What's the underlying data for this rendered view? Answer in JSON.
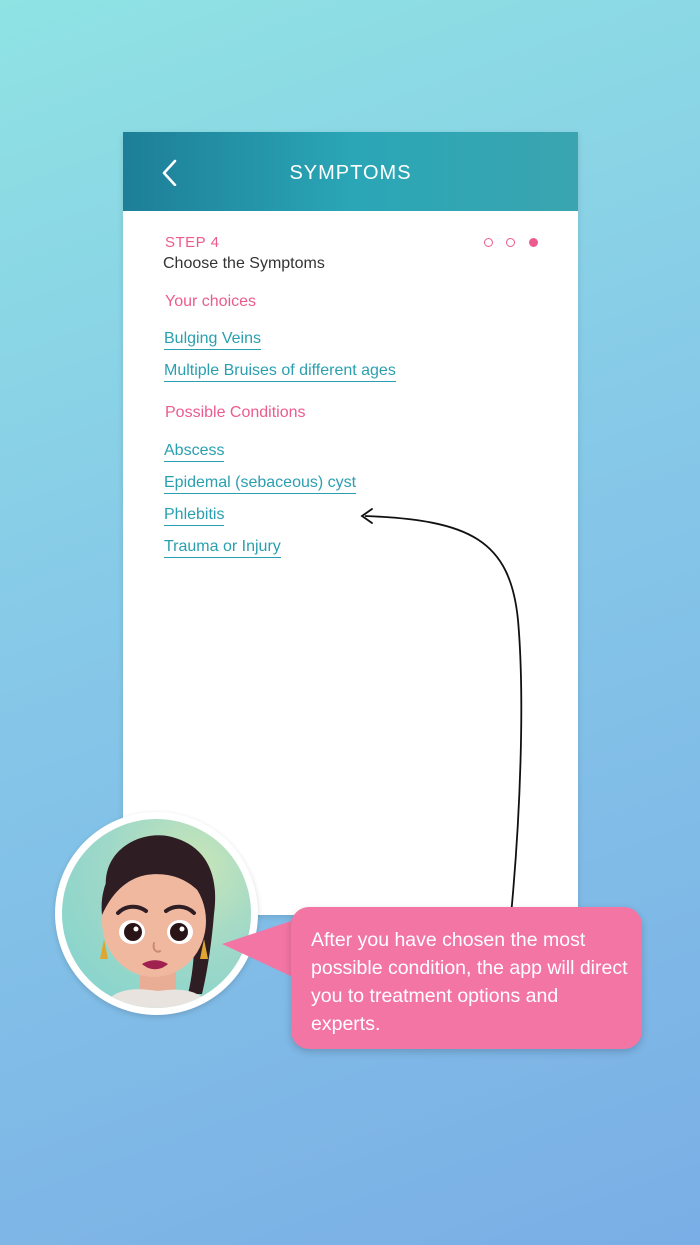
{
  "header": {
    "title": "SYMPTOMS",
    "back_icon": "chevron-left-icon"
  },
  "step": {
    "label": "STEP 4",
    "subtitle": "Choose the Symptoms",
    "current": 3,
    "total": 3
  },
  "your_choices": {
    "heading": "Your choices",
    "items": [
      "Bulging Veins ",
      "Multiple Bruises of different ages"
    ]
  },
  "possible_conditions": {
    "heading": "Possible Conditions",
    "items": [
      "Abscess",
      "Epidemal (sebaceous) cyst",
      "Phlebitis",
      "Trauma or Injury"
    ]
  },
  "tooltip": {
    "text": "After you have chosen the most possible condition, the app will direct you to treatment options and experts."
  },
  "colors": {
    "accent_pink": "#ec5b8e",
    "link_teal": "#2a9fb0",
    "header_teal": "#2aa6b6",
    "bubble_pink": "#f375a4"
  }
}
